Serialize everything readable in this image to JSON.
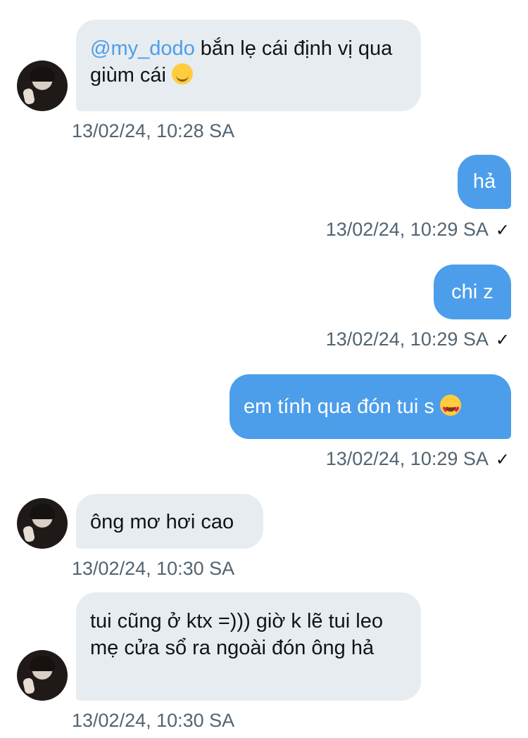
{
  "messages": [
    {
      "mention": "@my_dodo",
      "text": " bắn lẹ cái định vị qua giùm cái",
      "emoji": "hugging-face",
      "time": "13/02/24, 10:28 SA"
    },
    {
      "text": "hả",
      "time": "13/02/24, 10:29 SA",
      "status": "✓"
    },
    {
      "text": "chi z",
      "time": "13/02/24, 10:29 SA",
      "status": "✓"
    },
    {
      "text": "em tính qua đón tui s",
      "emoji": "heart-eyes",
      "time": "13/02/24, 10:29 SA",
      "status": "✓"
    },
    {
      "text": "ông mơ hơi cao",
      "time": "13/02/24, 10:30 SA"
    },
    {
      "text": "tui cũng ở ktx =))) giờ k lẽ tui leo mẹ cửa sổ ra ngoài đón ông hả",
      "time": "13/02/24, 10:30 SA"
    }
  ],
  "colors": {
    "incoming_bubble": "#e7ecf0",
    "outgoing_bubble": "#4c9eea",
    "mention": "#4c9eea",
    "timestamp": "#536471"
  }
}
